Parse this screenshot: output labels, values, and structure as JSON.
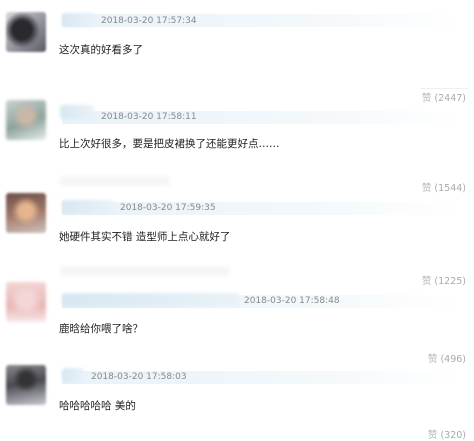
{
  "comments": [
    {
      "timestamp": "2018-03-20 17:57:34",
      "text": "这次真的好看多了",
      "like_label": "赞",
      "like_count": "(2447)"
    },
    {
      "timestamp": "2018-03-20 17:58:11",
      "text": "比上次好很多，要是把皮裙换了还能更好点……",
      "like_label": "赞",
      "like_count": "(1544)"
    },
    {
      "timestamp": "2018-03-20 17:59:35",
      "text": "她硬件其实不错 造型师上点心就好了",
      "like_label": "赞",
      "like_count": "(1225)"
    },
    {
      "timestamp": "2018-03-20 17:58:48",
      "text": "鹿晗给你喂了啥？",
      "like_label": "赞",
      "like_count": "(496)"
    },
    {
      "timestamp": "2018-03-20 17:58:03",
      "text": "哈哈哈哈哈 美的",
      "like_label": "赞",
      "like_count": "(320)"
    }
  ]
}
